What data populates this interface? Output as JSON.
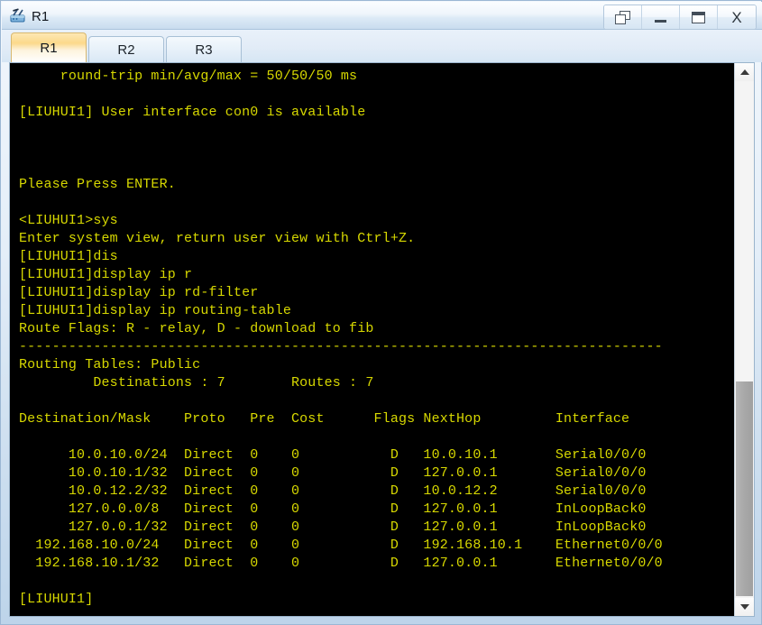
{
  "window": {
    "title": "R1",
    "icon": "router-icon",
    "buttons": [
      {
        "name": "restore-window-button",
        "icon": "restore-icon",
        "label": ""
      },
      {
        "name": "minimize-window-button",
        "icon": "minimize-icon",
        "label": ""
      },
      {
        "name": "maximize-window-button",
        "icon": "maximize-icon",
        "label": ""
      },
      {
        "name": "close-window-button",
        "icon": "close-icon",
        "label": "X"
      }
    ]
  },
  "tabs": [
    {
      "label": "R1",
      "active": true
    },
    {
      "label": "R2",
      "active": false
    },
    {
      "label": "R3",
      "active": false
    }
  ],
  "terminal": {
    "hostname": "LIUHUI1",
    "foreground_color": "#d7d800",
    "background_color": "#000000",
    "text": "     round-trip min/avg/max = 50/50/50 ms\n\n[LIUHUI1] User interface con0 is available\n\n\n\nPlease Press ENTER.\n\n<LIUHUI1>sys\nEnter system view, return user view with Ctrl+Z.\n[LIUHUI1]dis\n[LIUHUI1]display ip r\n[LIUHUI1]display ip rd-filter\n[LIUHUI1]display ip routing-table\nRoute Flags: R - relay, D - download to fib\n------------------------------------------------------------------------------\nRouting Tables: Public\n         Destinations : 7        Routes : 7\n\nDestination/Mask    Proto   Pre  Cost      Flags NextHop         Interface\n\n      10.0.10.0/24  Direct  0    0           D   10.0.10.1       Serial0/0/0\n      10.0.10.1/32  Direct  0    0           D   127.0.0.1       Serial0/0/0\n      10.0.12.2/32  Direct  0    0           D   10.0.12.2       Serial0/0/0\n      127.0.0.0/8   Direct  0    0           D   127.0.0.1       InLoopBack0\n      127.0.0.1/32  Direct  0    0           D   127.0.0.1       InLoopBack0\n  192.168.10.0/24   Direct  0    0           D   192.168.10.1    Ethernet0/0/0\n  192.168.10.1/32   Direct  0    0           D   127.0.0.1       Ethernet0/0/0\n\n[LIUHUI1]",
    "ping_summary": "round-trip min/avg/max = 50/50/50 ms",
    "console_notice": "[LIUHUI1] User interface con0 is available",
    "press_enter": "Please Press ENTER.",
    "commands": [
      "<LIUHUI1>sys",
      "Enter system view, return user view with Ctrl+Z.",
      "[LIUHUI1]dis",
      "[LIUHUI1]display ip r",
      "[LIUHUI1]display ip rd-filter",
      "[LIUHUI1]display ip routing-table"
    ],
    "route_flags": "Route Flags: R - relay, D - download to fib",
    "separator": "------------------------------------------------------------------------------",
    "table_name": "Routing Tables: Public",
    "destinations_count": "7",
    "routes_count": "7",
    "counts_line": "         Destinations : 7        Routes : 7",
    "columns": [
      "Destination/Mask",
      "Proto",
      "Pre",
      "Cost",
      "Flags",
      "NextHop",
      "Interface"
    ],
    "rows": [
      {
        "destination": "10.0.10.0/24",
        "proto": "Direct",
        "pre": "0",
        "cost": "0",
        "flags": "D",
        "nexthop": "10.0.10.1",
        "interface": "Serial0/0/0"
      },
      {
        "destination": "10.0.10.1/32",
        "proto": "Direct",
        "pre": "0",
        "cost": "0",
        "flags": "D",
        "nexthop": "127.0.0.1",
        "interface": "Serial0/0/0"
      },
      {
        "destination": "10.0.12.2/32",
        "proto": "Direct",
        "pre": "0",
        "cost": "0",
        "flags": "D",
        "nexthop": "10.0.12.2",
        "interface": "Serial0/0/0"
      },
      {
        "destination": "127.0.0.0/8",
        "proto": "Direct",
        "pre": "0",
        "cost": "0",
        "flags": "D",
        "nexthop": "127.0.0.1",
        "interface": "InLoopBack0"
      },
      {
        "destination": "127.0.0.1/32",
        "proto": "Direct",
        "pre": "0",
        "cost": "0",
        "flags": "D",
        "nexthop": "127.0.0.1",
        "interface": "InLoopBack0"
      },
      {
        "destination": "192.168.10.0/24",
        "proto": "Direct",
        "pre": "0",
        "cost": "0",
        "flags": "D",
        "nexthop": "192.168.10.1",
        "interface": "Ethernet0/0/0"
      },
      {
        "destination": "192.168.10.1/32",
        "proto": "Direct",
        "pre": "0",
        "cost": "0",
        "flags": "D",
        "nexthop": "127.0.0.1",
        "interface": "Ethernet0/0/0"
      }
    ],
    "prompt": "[LIUHUI1]"
  },
  "scrollbar": {
    "up_arrow": "scroll-up-arrow",
    "down_arrow": "scroll-down-arrow"
  }
}
